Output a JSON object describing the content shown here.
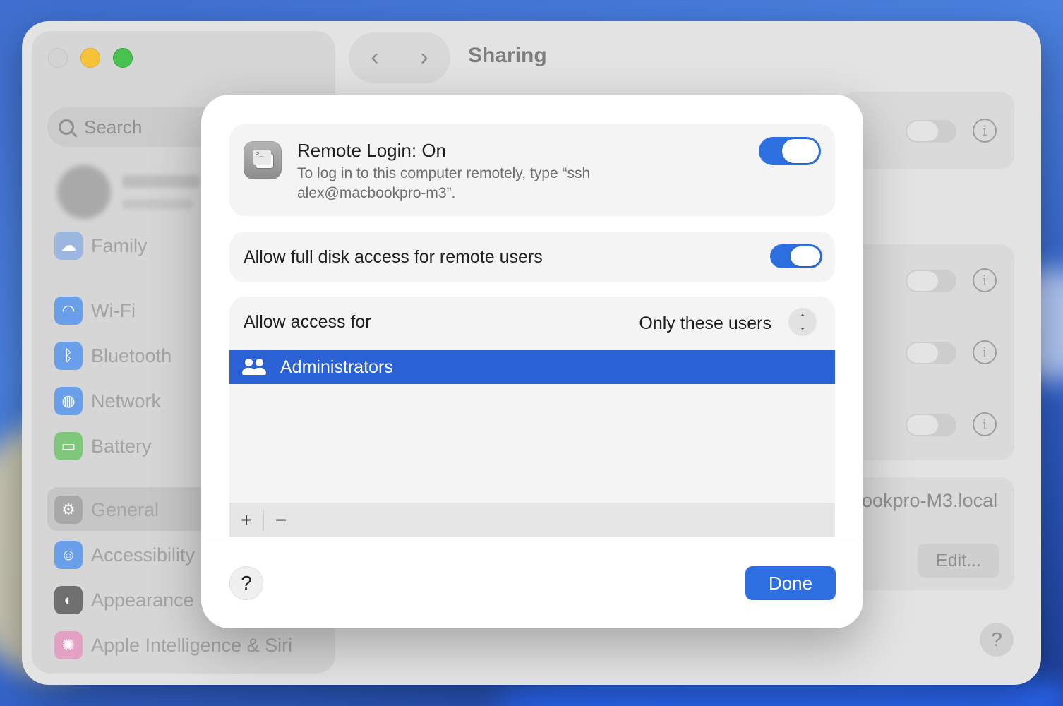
{
  "window": {
    "title": "Sharing",
    "nav_back": "‹",
    "nav_forward": "›"
  },
  "sidebar": {
    "search_placeholder": "Search",
    "items": [
      {
        "label": "Family",
        "icon": "family-icon",
        "color": "#9bb7e0"
      },
      {
        "label": "Wi-Fi",
        "icon": "wifi-icon",
        "color": "#6aa0ea"
      },
      {
        "label": "Bluetooth",
        "icon": "bluetooth-icon",
        "color": "#6aa0ea"
      },
      {
        "label": "Network",
        "icon": "globe-icon",
        "color": "#6aa0ea"
      },
      {
        "label": "Battery",
        "icon": "battery-icon",
        "color": "#7fc77a"
      },
      {
        "label": "General",
        "icon": "gear-icon",
        "color": "#a8a8a8"
      },
      {
        "label": "Accessibility",
        "icon": "accessibility-icon",
        "color": "#6aa0ea"
      },
      {
        "label": "Appearance",
        "icon": "appearance-icon",
        "color": "#6f6f6f"
      },
      {
        "label": "Apple Intelligence & Siri",
        "icon": "siri-icon",
        "color": "#e3a2c4"
      }
    ]
  },
  "background": {
    "hostname_partial": "ookpro-M3.local",
    "edit_button": "Edit...",
    "help": "?"
  },
  "sheet": {
    "remote_login": {
      "title": "Remote Login: On",
      "description": "To log in to this computer remotely, type “ssh alex@macbookpro-m3”.",
      "enabled": true,
      "icon": "terminal-icon",
      "icon_prompt": ">_"
    },
    "full_disk": {
      "label": "Allow full disk access for remote users",
      "enabled": true
    },
    "access": {
      "label": "Allow access for",
      "selected": "Only these users",
      "users": [
        {
          "name": "Administrators",
          "icon": "users-icon",
          "selected": true
        }
      ],
      "add_label": "+",
      "remove_label": "−"
    },
    "help_label": "?",
    "done_label": "Done",
    "accent": "#2d6fe0",
    "selection": "#2b62d6"
  }
}
